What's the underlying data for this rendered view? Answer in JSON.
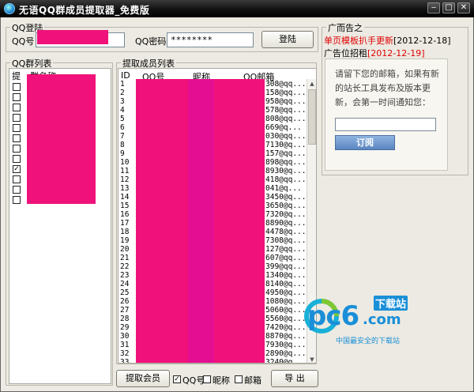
{
  "window": {
    "title": "无语QQ群成员提取器_免费版"
  },
  "login": {
    "group_label": "QQ登陆",
    "qq_label": "QQ号：",
    "password_label": "QQ密码：",
    "password_value": "********",
    "login_button": "登陆"
  },
  "groups": {
    "group_label": "QQ群列表",
    "col_select": "提",
    "col_name": "群名称",
    "rows": [
      {
        "checked": false
      },
      {
        "checked": false
      },
      {
        "checked": false
      },
      {
        "checked": false
      },
      {
        "checked": false
      },
      {
        "checked": false
      },
      {
        "checked": false
      },
      {
        "checked": false
      },
      {
        "checked": true
      },
      {
        "checked": false
      },
      {
        "checked": false
      },
      {
        "checked": false
      }
    ]
  },
  "members": {
    "group_label": "提取成员列表",
    "columns": [
      "ID",
      "QQ号",
      "昵称",
      "QQ邮箱"
    ],
    "rows": [
      {
        "id": "1",
        "mail": "308@qq..."
      },
      {
        "id": "2",
        "mail": "158@qq..."
      },
      {
        "id": "3",
        "mail": "958@qq..."
      },
      {
        "id": "4",
        "mail": "578@qq..."
      },
      {
        "id": "5",
        "mail": "808@qq..."
      },
      {
        "id": "6",
        "mail": "669@q..."
      },
      {
        "id": "7",
        "mail": "030@qq..."
      },
      {
        "id": "8",
        "mail": "7130@q..."
      },
      {
        "id": "9",
        "mail": "157@qq..."
      },
      {
        "id": "10",
        "mail": "898@qq..."
      },
      {
        "id": "11",
        "mail": "8930@q..."
      },
      {
        "id": "12",
        "mail": "418@qq..."
      },
      {
        "id": "13",
        "mail": "041@q..."
      },
      {
        "id": "14",
        "mail": "3450@q..."
      },
      {
        "id": "15",
        "mail": "3650@q..."
      },
      {
        "id": "16",
        "mail": "7320@q..."
      },
      {
        "id": "17",
        "mail": "8890@q..."
      },
      {
        "id": "18",
        "mail": "4478@q..."
      },
      {
        "id": "19",
        "mail": "7308@q..."
      },
      {
        "id": "20",
        "mail": "127@qq..."
      },
      {
        "id": "21",
        "mail": "607@qq..."
      },
      {
        "id": "22",
        "mail": "399@qq..."
      },
      {
        "id": "23",
        "mail": "1340@q..."
      },
      {
        "id": "24",
        "mail": "8140@q..."
      },
      {
        "id": "25",
        "mail": "4950@q..."
      },
      {
        "id": "26",
        "mail": "1080@q..."
      },
      {
        "id": "27",
        "mail": "5060@q..."
      },
      {
        "id": "28",
        "mail": "5560@q..."
      },
      {
        "id": "29",
        "mail": "7420@q..."
      },
      {
        "id": "30",
        "mail": "8870@q..."
      },
      {
        "id": "31",
        "mail": "7930@q..."
      },
      {
        "id": "32",
        "mail": "2890@q..."
      },
      {
        "id": "33",
        "mail": "3240@q..."
      }
    ]
  },
  "footer": {
    "extract_button": "提取会员",
    "opt_qq": "QQ号",
    "opt_qq_checked": true,
    "opt_nick": "昵称",
    "opt_nick_checked": false,
    "opt_mail": "邮箱",
    "opt_mail_checked": false,
    "export_button": "导 出"
  },
  "ads": {
    "group_label": "广而告之",
    "line1_red": "单页模板扒手更新",
    "line1_date": "[2012-12-18]",
    "line2_text": "广告位招租",
    "line2_date": "[2012-12-19]",
    "subscribe_text_1": "请留下您的邮箱，如果有新",
    "subscribe_text_2": "的站长工具发布及版本更",
    "subscribe_text_3": "新，会第一时间通知您：",
    "subscribe_button": "订阅",
    "email_placeholder": ""
  },
  "watermark": {
    "logo_text_1": "pc6",
    "logo_text_2": ".com",
    "logo_badge": "下载站",
    "slogan": "中国最安全的下载站"
  },
  "colors": {
    "redact": "#f0127a",
    "ad_red": "#e00000",
    "title_bg": "#111111",
    "watermark_blue": "#1a8fd8"
  }
}
